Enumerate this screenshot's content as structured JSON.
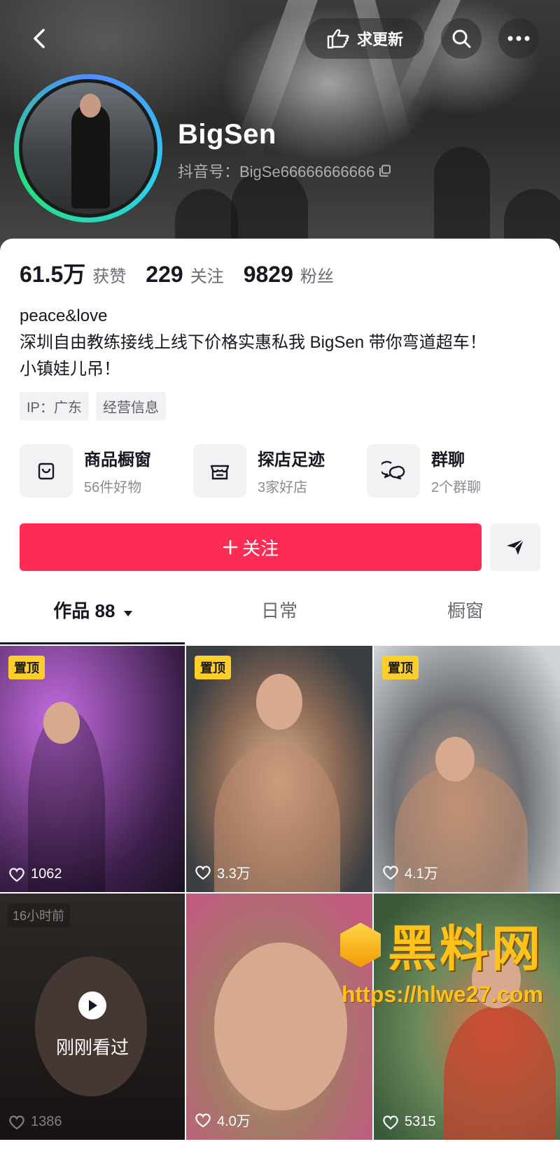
{
  "header": {
    "request_update_label": "求更新",
    "username": "BigSen",
    "douyin_id": "抖音号：BigSe66666666666"
  },
  "stats": [
    {
      "value": "61.5万",
      "label": "获赞"
    },
    {
      "value": "229",
      "label": "关注"
    },
    {
      "value": "9829",
      "label": "粉丝"
    }
  ],
  "bio": {
    "line1": "peace&love",
    "line2": "深圳自由教练接线上线下价格实惠私我 BigSen 带你弯道超车！",
    "line3": "小镇娃儿吊！"
  },
  "tags": [
    "IP：广东",
    "经营信息"
  ],
  "features": [
    {
      "title": "商品橱窗",
      "sub": "56件好物",
      "icon": "bag-icon"
    },
    {
      "title": "探店足迹",
      "sub": "3家好店",
      "icon": "store-icon"
    },
    {
      "title": "群聊",
      "sub": "2个群聊",
      "icon": "chat-icon"
    }
  ],
  "actions": {
    "follow_label": "关注"
  },
  "tabs": [
    {
      "label": "作品 88",
      "active": true
    },
    {
      "label": "日常",
      "active": false
    },
    {
      "label": "橱窗",
      "active": false
    }
  ],
  "videos": [
    {
      "pinned_label": "置顶",
      "likes": "1062"
    },
    {
      "pinned_label": "置顶",
      "likes": "3.3万"
    },
    {
      "pinned_label": "置顶",
      "likes": "4.1万"
    },
    {
      "time_label": "16小时前",
      "watched_label": "刚刚看过",
      "likes": "1386"
    },
    {
      "likes": "4.0万"
    },
    {
      "likes": "5315"
    }
  ],
  "watermark": {
    "brand": "黑料网",
    "url": "https://hlwe27.com"
  },
  "colors": {
    "follow": "#fe2c55",
    "pin": "#fece2a",
    "watermark": "#ffc21a"
  }
}
